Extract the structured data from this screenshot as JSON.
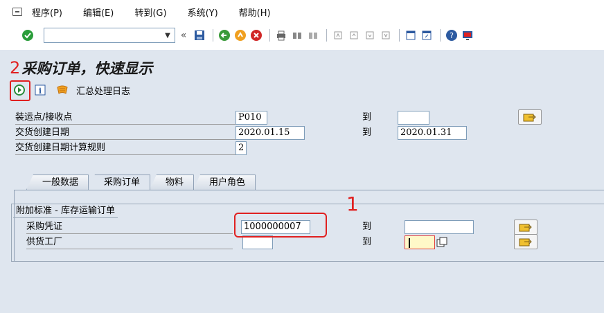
{
  "menu": {
    "items": [
      "程序(P)",
      "编辑(E)",
      "转到(G)",
      "系统(Y)",
      "帮助(H)"
    ]
  },
  "toolbar": {
    "command_value": "",
    "icons": [
      "ok-check",
      "save",
      "back",
      "exit",
      "cancel",
      "print",
      "find",
      "find-next",
      "first-page",
      "prev-page",
      "next-page",
      "last-page",
      "new-session",
      "shortcut",
      "help",
      "customize"
    ]
  },
  "title": {
    "annotation": "2",
    "text": "采购订单，快速显示"
  },
  "app_toolbar": {
    "log_label": "汇总处理日志"
  },
  "selection": {
    "rows": [
      {
        "label": "装运点/接收点",
        "from": "P010",
        "to_label": "到",
        "to": ""
      },
      {
        "label": "交货创建日期",
        "from": "2020.01.15",
        "to_label": "到",
        "to": "2020.01.31"
      },
      {
        "label": "交货创建日期计算规则",
        "from": "2"
      }
    ]
  },
  "tabs": [
    "一般数据",
    "采购订单",
    "物料",
    "用户角色"
  ],
  "active_tab": "采购订单",
  "group": {
    "title": "附加标准 - 库存运输订单",
    "annotation": "1",
    "rows": [
      {
        "label": "采购凭证",
        "from": "1000000007",
        "to_label": "到",
        "to": ""
      },
      {
        "label": "供货工厂",
        "from": "",
        "to_label": "到",
        "to": ""
      }
    ]
  },
  "colors": {
    "annotation_red": "#e02020",
    "background": "#dfe6ef",
    "input_border": "#7f9db9"
  }
}
